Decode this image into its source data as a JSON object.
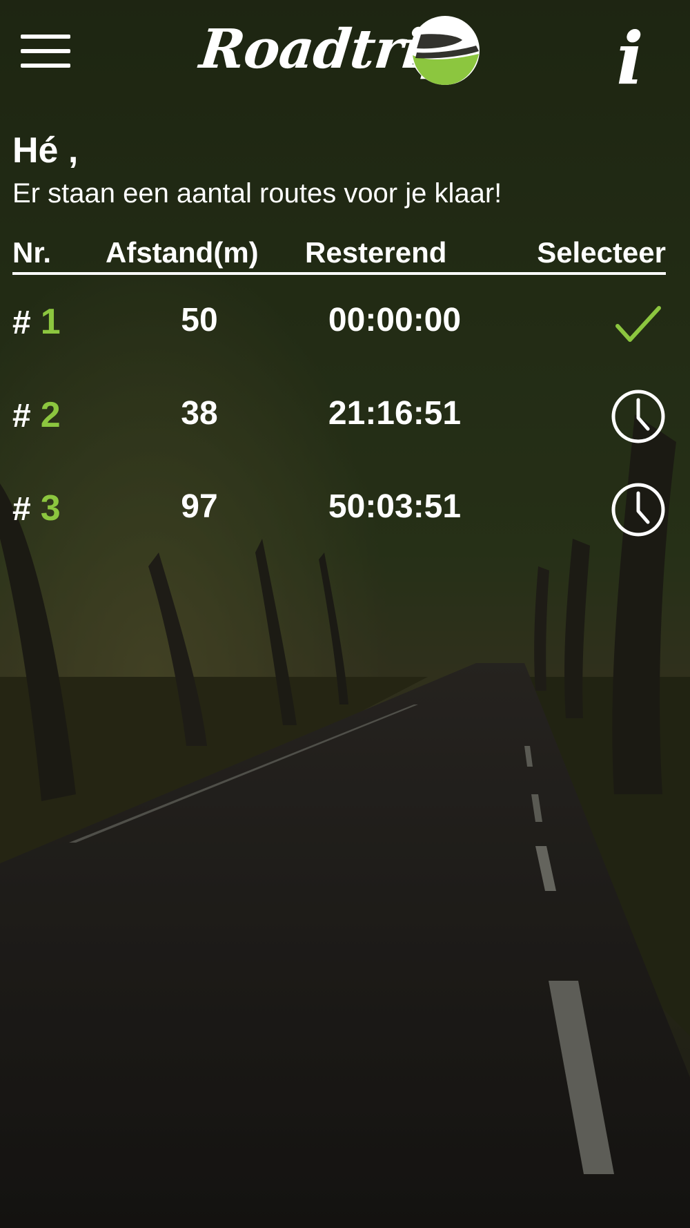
{
  "header": {
    "logo_text": "Roadtrip",
    "menu_icon": "hamburger-menu-icon",
    "info_label": "i"
  },
  "greeting": {
    "title": "Hé ,",
    "subtitle": "Er staan een aantal routes voor je klaar!"
  },
  "table": {
    "columns": {
      "nr": "Nr.",
      "distance": "Afstand(m)",
      "remaining": "Resterend",
      "select": "Selecteer"
    },
    "rows": [
      {
        "hash": "#",
        "nr": "1",
        "distance": "50",
        "remaining": "00:00:00",
        "status_icon": "checkmark-icon"
      },
      {
        "hash": "#",
        "nr": "2",
        "distance": "38",
        "remaining": "21:16:51",
        "status_icon": "clock-icon"
      },
      {
        "hash": "#",
        "nr": "3",
        "distance": "97",
        "remaining": "50:03:51",
        "status_icon": "clock-icon"
      }
    ]
  },
  "colors": {
    "accent_green": "#8cc63f",
    "text": "#ffffff",
    "background_dark": "#1c1c16"
  }
}
